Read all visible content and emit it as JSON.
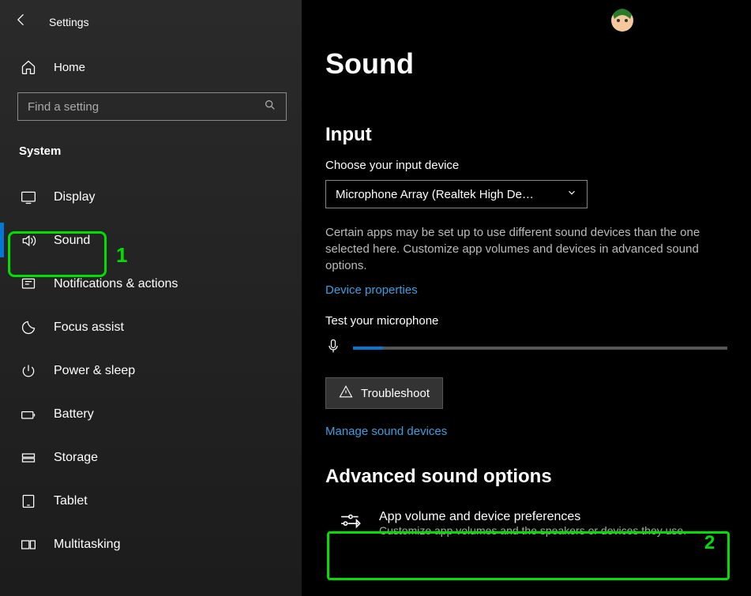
{
  "header": {
    "back": "back",
    "title": "Settings",
    "home": "Home",
    "search_placeholder": "Find a setting",
    "category": "System"
  },
  "nav": [
    {
      "icon": "display",
      "label": "Display"
    },
    {
      "icon": "sound",
      "label": "Sound"
    },
    {
      "icon": "notifications",
      "label": "Notifications & actions"
    },
    {
      "icon": "focus",
      "label": "Focus assist"
    },
    {
      "icon": "power",
      "label": "Power & sleep"
    },
    {
      "icon": "battery",
      "label": "Battery"
    },
    {
      "icon": "storage",
      "label": "Storage"
    },
    {
      "icon": "tablet",
      "label": "Tablet"
    },
    {
      "icon": "multitasking",
      "label": "Multitasking"
    }
  ],
  "main": {
    "title": "Sound",
    "input_heading": "Input",
    "choose_label": "Choose your input device",
    "dropdown_value": "Microphone Array (Realtek High De…",
    "desc": "Certain apps may be set up to use different sound devices than the one selected here. Customize app volumes and devices in advanced sound options.",
    "device_props": "Device properties",
    "test_label": "Test your microphone",
    "troubleshoot": "Troubleshoot",
    "manage": "Manage sound devices",
    "advanced_heading": "Advanced sound options",
    "adv_title": "App volume and device preferences",
    "adv_sub": "Customize app volumes and the speakers or devices they use."
  },
  "annotations": {
    "one": "1",
    "two": "2"
  }
}
